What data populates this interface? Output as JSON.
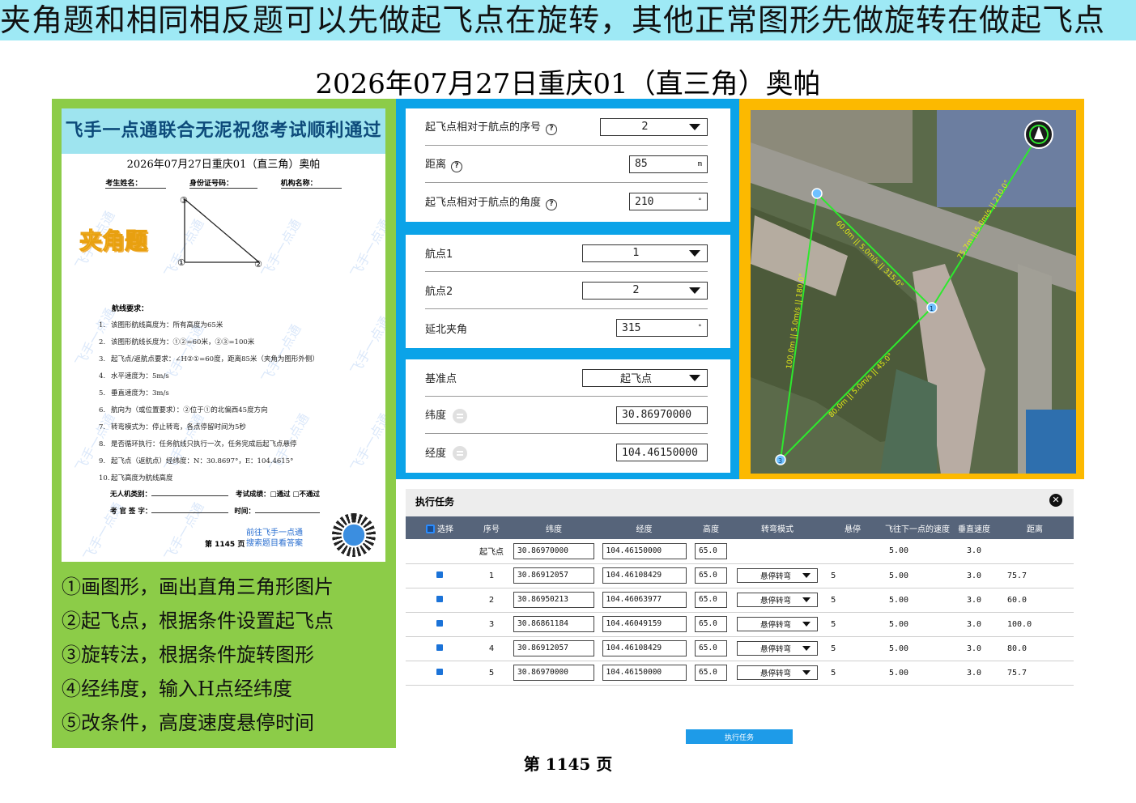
{
  "banner": "夹角题和相同相反题可以先做起飞点在旋转，其他正常图形先做旋转在做起飞点",
  "page_title": "2026年07月27日重庆01（直三角）奥帕",
  "paper": {
    "header": "飞手一点通联合无泥祝您考试顺利通过",
    "subtitle": "2026年07月27日重庆01（直三角）奥帕",
    "fields": [
      "考生姓名：",
      "身份证号码：",
      "机构名称："
    ],
    "tag": "夹角题",
    "watermark": "飞手一点通",
    "vertices": [
      "①",
      "②",
      "③"
    ],
    "req_title": "航线要求：",
    "requirements": [
      {
        "n": "1.",
        "t": "该图形航线高度为：所有高度为65米"
      },
      {
        "n": "2.",
        "t": "该图形航线长度为：①②=60米，②③=100米"
      },
      {
        "n": "3.",
        "t": "起飞点/返航点要求：∠H②①=60度，距离85米（夹角为图形外侧）"
      },
      {
        "n": "4.",
        "t": "水平速度为：5m/s"
      },
      {
        "n": "5.",
        "t": "垂直速度为：3m/s"
      },
      {
        "n": "6.",
        "t": "航向为（或位置要求）：②位于①的北偏西45度方向"
      },
      {
        "n": "7.",
        "t": "转弯模式为：停止转弯，各点停留时间为5秒"
      },
      {
        "n": "8.",
        "t": "是否循环执行：任务航线只执行一次，任务完成后起飞点悬停"
      },
      {
        "n": "9.",
        "t": "起飞点（返航点）经纬度：N：30.8697°，E：104.4615°"
      },
      {
        "n": "10.",
        "t": "起飞高度为航线高度"
      }
    ],
    "uav_label": "无人机类别：",
    "result_label": "考试成绩：□通过  □不通过",
    "examiner_label": "考 官 签 字：",
    "time_label": "时间：",
    "link_line1": "前往飞手一点通",
    "link_line2": "搜索题目看答案",
    "page_label": "第 1145 页"
  },
  "steps": [
    "①画图形，画出直角三角形图片",
    "②起飞点，根据条件设置起飞点",
    "③旋转法，根据条件旋转图形",
    "④经纬度，输入H点经纬度",
    "⑤改条件，高度速度悬停时间"
  ],
  "takeoff_card": {
    "seq_label": "起飞点相对于航点的序号",
    "seq_value": "2",
    "dist_label": "距离",
    "dist_value": "85",
    "dist_unit": "m",
    "angle_label": "起飞点相对于航点的角度",
    "angle_value": "210",
    "angle_unit": "°",
    "help": "?"
  },
  "waypoint_card": {
    "wp1_label": "航点1",
    "wp1_value": "1",
    "wp2_label": "航点2",
    "wp2_value": "2",
    "north_label": "延北夹角",
    "north_value": "315",
    "north_unit": "°"
  },
  "base_card": {
    "base_label": "基准点",
    "base_value": "起飞点",
    "lat_label": "纬度",
    "lat_value": "30.86970000",
    "lng_label": "经度",
    "lng_value": "104.46150000"
  },
  "map": {
    "labels": [
      "1",
      "3"
    ],
    "seg_labels": [
      "60.0m || 5.0m/s || 315.0°",
      "100.0m || 5.0m/s || 180.0°",
      "80.0m || 5.0m/s || 45.0°",
      "75.7m || 5.0m/s || 210.0°"
    ]
  },
  "task": {
    "title": "执行任务",
    "close": "✕",
    "columns": [
      "选择",
      "序号",
      "纬度",
      "经度",
      "高度",
      "转弯模式",
      "悬停",
      "飞往下一点的速度",
      "垂直速度",
      "距离"
    ],
    "rows": [
      {
        "seq": "起飞点",
        "lat": "30.86970000",
        "lng": "104.46150000",
        "alt": "65.0",
        "mode": "",
        "hover": "",
        "speed": "5.00",
        "vspeed": "3.0",
        "dist": ""
      },
      {
        "seq": "1",
        "lat": "30.86912057",
        "lng": "104.46108429",
        "alt": "65.0",
        "mode": "悬停转弯",
        "hover": "5",
        "speed": "5.00",
        "vspeed": "3.0",
        "dist": "75.7"
      },
      {
        "seq": "2",
        "lat": "30.86950213",
        "lng": "104.46063977",
        "alt": "65.0",
        "mode": "悬停转弯",
        "hover": "5",
        "speed": "5.00",
        "vspeed": "3.0",
        "dist": "60.0"
      },
      {
        "seq": "3",
        "lat": "30.86861184",
        "lng": "104.46049159",
        "alt": "65.0",
        "mode": "悬停转弯",
        "hover": "5",
        "speed": "5.00",
        "vspeed": "3.0",
        "dist": "100.0"
      },
      {
        "seq": "4",
        "lat": "30.86912057",
        "lng": "104.46108429",
        "alt": "65.0",
        "mode": "悬停转弯",
        "hover": "5",
        "speed": "5.00",
        "vspeed": "3.0",
        "dist": "80.0"
      },
      {
        "seq": "5",
        "lat": "30.86970000",
        "lng": "104.46150000",
        "alt": "65.0",
        "mode": "悬停转弯",
        "hover": "5",
        "speed": "5.00",
        "vspeed": "3.0",
        "dist": "75.7"
      }
    ],
    "exec_button": "执行任务"
  },
  "bottom_page": "第 1145 页"
}
